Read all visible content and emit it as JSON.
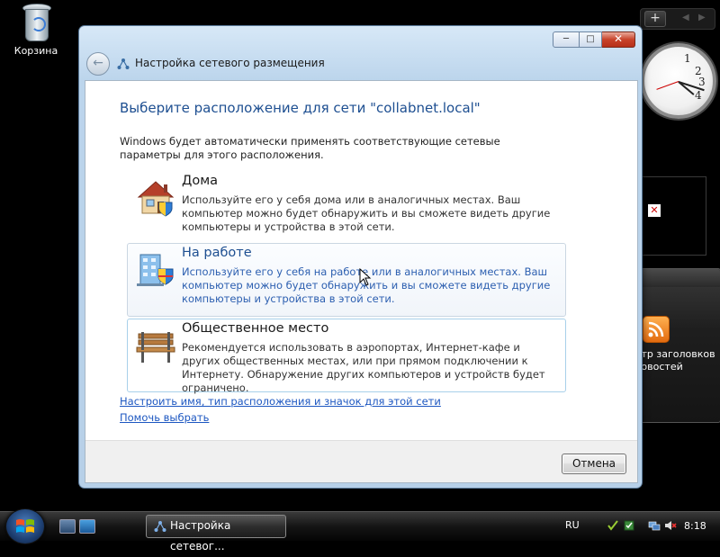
{
  "desktop": {
    "recycle_bin_label": "Корзина"
  },
  "sidebar": {
    "add_label": "+",
    "prev_label": "◀",
    "next_label": "▶",
    "feed_title": "Просмотр заголовков новостей",
    "clock_numbers": {
      "n1": "1",
      "n2": "2",
      "n3": "3",
      "n4": "4"
    },
    "clock_time": "8:18"
  },
  "window": {
    "title": "Настройка сетевого размещения",
    "min_label": "─",
    "max_label": "□",
    "close_label": "✕",
    "heading": "Выберите расположение для сети \"collabnet.local\"",
    "description": "Windows будет автоматически применять соответствующие сетевые параметры для этого расположения.",
    "options": [
      {
        "title": "Дома",
        "desc": "Используйте его у себя дома или в аналогичных местах. Ваш компьютер можно будет обнаружить и вы сможете видеть другие компьютеры и устройства в этой сети."
      },
      {
        "title": "На работе",
        "desc": "Используйте его у себя на работе или в аналогичных местах. Ваш компьютер можно будет обнаружить и вы сможете видеть другие компьютеры и устройства в этой сети."
      },
      {
        "title": "Общественное место",
        "desc": "Рекомендуется использовать в аэропортах, Интернет-кафе и других общественных местах, или при прямом подключении к Интернету. Обнаружение других компьютеров и устройств будет ограничено."
      }
    ],
    "link_customize": "Настроить имя, тип расположения и значок для этой сети",
    "link_help": "Помочь выбрать",
    "cancel_label": "Отмена"
  },
  "taskbar": {
    "task_label": "Настройка сетевог...",
    "lang": "RU",
    "time": "8:18"
  },
  "colors": {
    "heading": "#1e4f91",
    "link": "#1d57c1",
    "hover_text": "#2c5fb0"
  }
}
